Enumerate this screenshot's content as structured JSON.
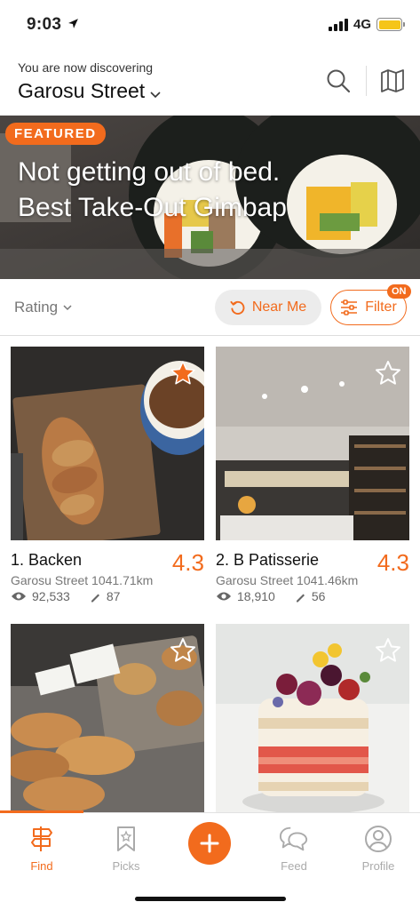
{
  "status": {
    "time": "9:03",
    "network": "4G"
  },
  "header": {
    "discover_label": "You are now discovering",
    "location": "Garosu Street"
  },
  "featured": {
    "badge": "FEATURED",
    "title": "Not getting out of bed.\nBest Take-Out Gimbap"
  },
  "filters": {
    "sort": "Rating",
    "near_me": "Near Me",
    "filter": "Filter",
    "filter_badge": "ON"
  },
  "places": [
    {
      "name": "1. Backen",
      "rating": "4.3",
      "address": "Garosu Street 1041.71km",
      "views": "92,533",
      "reviews": "87",
      "favorited": true
    },
    {
      "name": "2. B Patisserie",
      "rating": "4.3",
      "address": "Garosu Street 1041.46km",
      "views": "18,910",
      "reviews": "56",
      "favorited": false
    },
    {
      "favorited": false
    },
    {
      "favorited": false
    }
  ],
  "tabs": [
    {
      "label": "Find",
      "icon": "signpost-icon",
      "active": true
    },
    {
      "label": "Picks",
      "icon": "bookmark-icon",
      "active": false
    },
    {
      "label": "Feed",
      "icon": "chat-bubbles-icon",
      "active": false
    },
    {
      "label": "Profile",
      "icon": "profile-icon",
      "active": false
    }
  ],
  "colors": {
    "accent": "#f26b1d",
    "battery": "#f5c518"
  }
}
